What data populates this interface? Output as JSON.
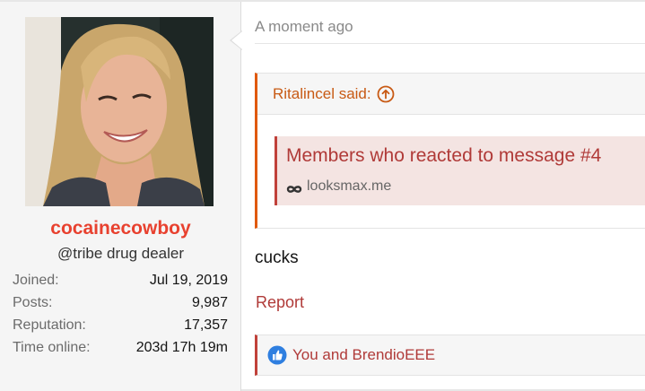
{
  "author": {
    "username": "cocainecowboy",
    "user_title": "@tribe drug dealer",
    "stats": [
      {
        "label": "Joined:",
        "value": "Jul 19, 2019"
      },
      {
        "label": "Posts:",
        "value": "9,987"
      },
      {
        "label": "Reputation:",
        "value": "17,357"
      },
      {
        "label": "Time online:",
        "value": "203d 17h 19m"
      }
    ],
    "name_color": "#e8412f"
  },
  "post": {
    "timestamp": "A moment ago",
    "quote": {
      "author_said": "Ritalincel said:",
      "jump_icon": "arrow-up-circle-icon",
      "embed": {
        "title": "Members who reacted to message #4",
        "source_icon": "infinity-icon",
        "source": "looksmax.me"
      }
    },
    "body": "cucks",
    "report_label": "Report",
    "reactions": {
      "icon": "thumbs-up-icon",
      "text": "You and BrendioEEE"
    }
  },
  "colors": {
    "accent": "#b03a38",
    "quote_border": "#e0590e",
    "like_blue": "#2f7fe0"
  }
}
